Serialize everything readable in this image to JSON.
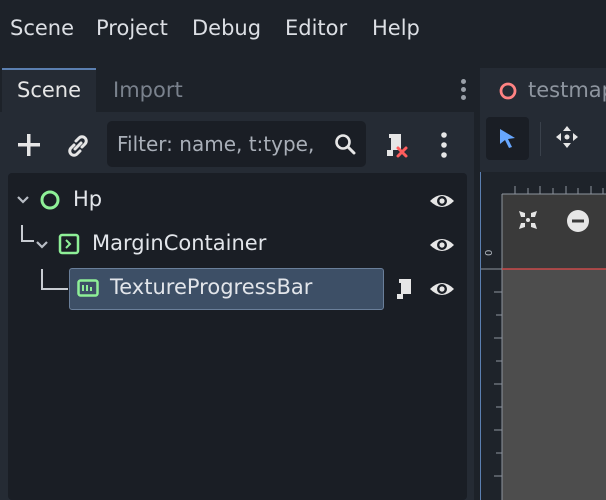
{
  "menu": {
    "items": [
      {
        "label": "Scene"
      },
      {
        "label": "Project"
      },
      {
        "label": "Debug"
      },
      {
        "label": "Editor"
      },
      {
        "label": "Help"
      }
    ]
  },
  "scene_dock": {
    "tabs": [
      {
        "label": "Scene",
        "active": true
      },
      {
        "label": "Import",
        "active": false
      }
    ],
    "toolbar": {
      "filter_placeholder": "Filter: name, t:type,"
    },
    "tree": {
      "nodes": [
        {
          "name": "Hp",
          "icon": "node2d-circle-icon",
          "visible": true
        },
        {
          "name": "MarginContainer",
          "icon": "container-icon",
          "visible": true
        },
        {
          "name": "TextureProgressBar",
          "icon": "progress-bar-icon",
          "visible": true,
          "selected": true,
          "has_script": true
        }
      ]
    }
  },
  "viewport": {
    "tab_label": "testmap",
    "ruler_label": "0"
  },
  "colors": {
    "accent": "#5b7fb0",
    "node_green": "#8eef97",
    "selection_bg": "#3d4f66",
    "script_red": "#ff5d5d"
  }
}
